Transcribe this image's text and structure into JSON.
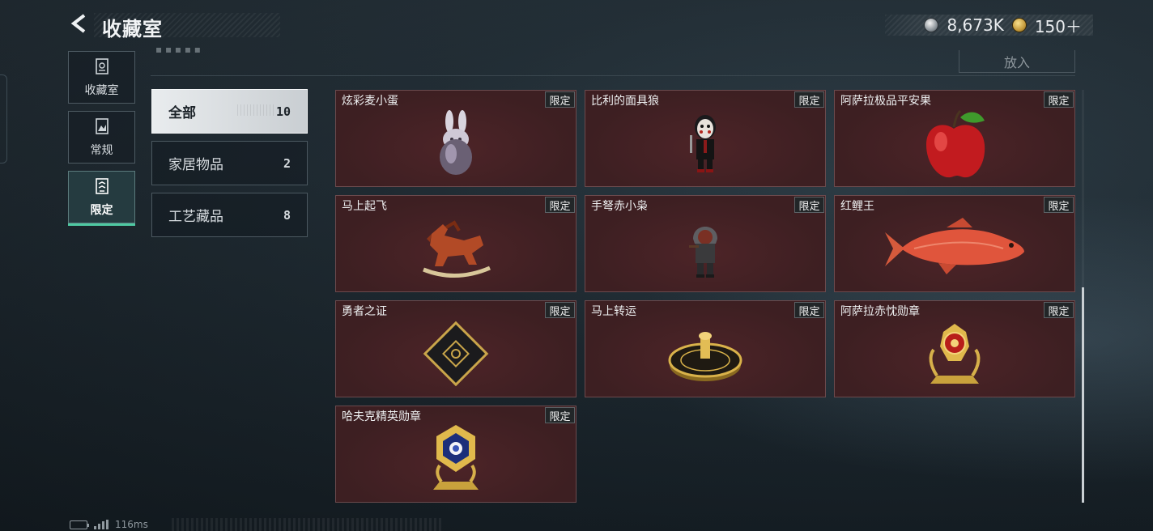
{
  "header": {
    "title": "收藏室",
    "currency": [
      {
        "icon": "silver-coin-icon",
        "amount": "8,673K"
      },
      {
        "icon": "gold-coin-icon",
        "amount": "150＋"
      }
    ]
  },
  "side_tabs": [
    {
      "label": "收藏室",
      "icon": "collection-room-icon",
      "active": false
    },
    {
      "label": "常规",
      "icon": "regular-icon",
      "active": false
    },
    {
      "label": "限定",
      "icon": "limited-icon",
      "active": true
    }
  ],
  "toolbar": {
    "put_label": "放入"
  },
  "categories": [
    {
      "name": "全部",
      "count": "10",
      "active": true
    },
    {
      "name": "家居物品",
      "count": "2",
      "active": false
    },
    {
      "name": "工艺藏品",
      "count": "8",
      "active": false
    }
  ],
  "items": [
    {
      "name": "炫彩麦小蛋",
      "badge": "限定",
      "art": "rabbit-egg-figurine"
    },
    {
      "name": "比利的面具狼",
      "badge": "限定",
      "art": "masked-doll-figurine"
    },
    {
      "name": "阿萨拉极品平安果",
      "badge": "限定",
      "art": "red-apple"
    },
    {
      "name": "马上起飞",
      "badge": "限定",
      "art": "rocking-horse"
    },
    {
      "name": "手弩赤小枭",
      "badge": "限定",
      "art": "hooded-figure"
    },
    {
      "name": "红鲤王",
      "badge": "限定",
      "art": "red-carp"
    },
    {
      "name": "勇者之证",
      "badge": "限定",
      "art": "black-card"
    },
    {
      "name": "马上转运",
      "badge": "限定",
      "art": "golden-roulette"
    },
    {
      "name": "阿萨拉赤忱勋章",
      "badge": "限定",
      "art": "gold-red-medal"
    },
    {
      "name": "哈夫克精英勋章",
      "badge": "限定",
      "art": "gold-blue-medal"
    }
  ],
  "status": {
    "ping": "116ms"
  },
  "colors": {
    "card_bg": "#3d1f22",
    "active_tab_accent": "#4ec9a2",
    "active_category_bg": "#e9ecee"
  }
}
